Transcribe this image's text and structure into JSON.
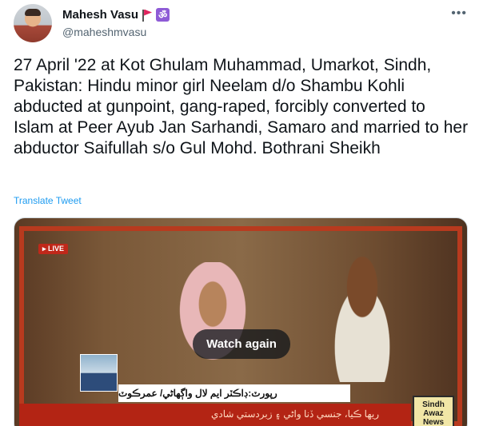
{
  "tweet": {
    "author_name": "Mahesh Vasu",
    "author_handle": "@maheshmvasu",
    "badge_icons": [
      "flag-icon",
      "om-icon"
    ],
    "om_glyph": "ॐ",
    "more_glyph": "•••",
    "text": "27 April '22 at Kot Ghulam Muhammad, Umarkot, Sindh, Pakistan: Hindu minor girl Neelam d/o Shambu Kohli abducted at gunpoint, gang-raped, forcibly converted to Islam at Peer Ayub Jan Sarhandi, Samaro and married to her abductor Saifullah s/o Gul Mohd. Bothrani Sheikh",
    "translate_label": "Translate Tweet"
  },
  "video": {
    "live_label": "LIVE",
    "ticker_text": "رپورٽ:ڊاڪٽر ايم لال واڳهاڻي/ عمرڪوٽ",
    "band_text": "ريها ڪيا، جنسي ڏنا واڻي ۽ زبردستي شادي",
    "channel_logo_line1": "Sindh",
    "channel_logo_line2": "Awaz",
    "channel_logo_line3": "News",
    "watch_again_label": "Watch again"
  },
  "colors": {
    "link": "#1d9bf0",
    "text": "#0f1419",
    "secondary": "#536471",
    "frame_red": "#b83a1e"
  }
}
